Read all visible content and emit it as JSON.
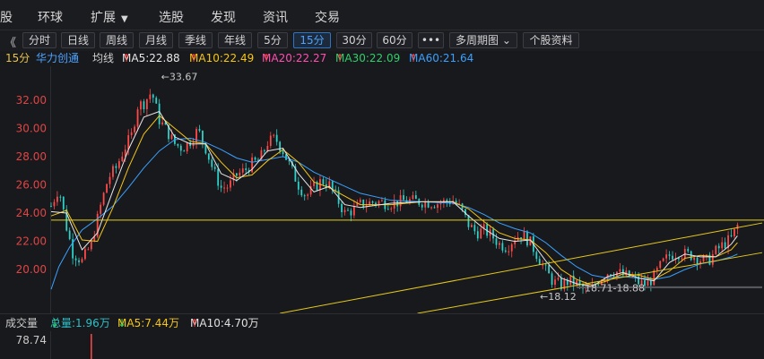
{
  "nav": {
    "items": [
      "股",
      "环球",
      "扩展",
      "选股",
      "发现",
      "资讯",
      "交易"
    ]
  },
  "toolbar": {
    "collapse": "《",
    "periods": [
      "分时",
      "日线",
      "周线",
      "月线",
      "季线",
      "年线",
      "5分",
      "15分",
      "30分",
      "60分",
      "•••",
      "多周期图",
      "个股资料"
    ],
    "active": "15分"
  },
  "ma_bar": {
    "period": "15分",
    "name": "华力创通",
    "ma_label": "均线",
    "ma5": "MA5:22.88",
    "ma10": "MA10:22.49",
    "ma20": "MA20:22.27",
    "ma30": "MA30:22.09",
    "ma60": "MA60:21.64",
    "up_arrow": "↑",
    "colors": {
      "ma5": "#e8e8e8",
      "ma10": "#f5c518",
      "ma20": "#ff4fb0",
      "ma30": "#2ed06a",
      "ma60": "#3aa0ff"
    }
  },
  "chart_data": {
    "type": "candlestick",
    "yticks": [
      "32.00",
      "30.00",
      "28.00",
      "26.00",
      "24.00",
      "22.00",
      "20.00"
    ],
    "ylim": [
      16.9,
      34.4
    ],
    "close_path": [
      [
        0,
        24.5
      ],
      [
        5,
        25.8
      ],
      [
        10,
        23.0
      ],
      [
        14,
        21.2
      ],
      [
        20,
        20.6
      ],
      [
        26,
        21.8
      ],
      [
        32,
        24.5
      ],
      [
        37,
        26.5
      ],
      [
        42,
        27.2
      ],
      [
        47,
        28.5
      ],
      [
        52,
        29.5
      ],
      [
        56,
        31.6
      ],
      [
        60,
        31.8
      ],
      [
        65,
        32.6
      ],
      [
        70,
        30.6
      ],
      [
        75,
        29.8
      ],
      [
        80,
        28.9
      ],
      [
        85,
        28.6
      ],
      [
        90,
        29.1
      ],
      [
        95,
        29.9
      ],
      [
        100,
        28.6
      ],
      [
        105,
        27.0
      ],
      [
        110,
        25.8
      ],
      [
        115,
        25.9
      ],
      [
        120,
        26.7
      ],
      [
        125,
        27.0
      ],
      [
        130,
        27.5
      ],
      [
        135,
        27.8
      ],
      [
        140,
        29.0
      ],
      [
        145,
        29.3
      ],
      [
        150,
        28.4
      ],
      [
        155,
        27.2
      ],
      [
        160,
        26.0
      ],
      [
        165,
        25.2
      ],
      [
        170,
        25.8
      ],
      [
        175,
        26.3
      ],
      [
        180,
        26.0
      ],
      [
        185,
        25.0
      ],
      [
        190,
        24.0
      ],
      [
        195,
        24.2
      ],
      [
        200,
        24.6
      ],
      [
        210,
        24.8
      ],
      [
        220,
        24.7
      ],
      [
        230,
        24.9
      ],
      [
        240,
        24.8
      ],
      [
        250,
        24.7
      ],
      [
        260,
        24.9
      ],
      [
        265,
        24.3
      ],
      [
        270,
        23.2
      ],
      [
        275,
        22.6
      ],
      [
        280,
        22.8
      ],
      [
        285,
        22.4
      ],
      [
        290,
        21.8
      ],
      [
        295,
        21.6
      ],
      [
        300,
        22.3
      ],
      [
        305,
        22.5
      ],
      [
        310,
        21.9
      ],
      [
        315,
        20.9
      ],
      [
        320,
        19.9
      ],
      [
        325,
        19.1
      ],
      [
        330,
        18.9
      ],
      [
        335,
        19.2
      ],
      [
        340,
        19.0
      ],
      [
        345,
        18.5
      ],
      [
        350,
        18.7
      ],
      [
        355,
        19.4
      ],
      [
        360,
        19.8
      ],
      [
        365,
        19.9
      ],
      [
        370,
        19.6
      ],
      [
        375,
        19.5
      ],
      [
        380,
        19.1
      ],
      [
        385,
        18.9
      ],
      [
        390,
        19.5
      ],
      [
        395,
        20.4
      ],
      [
        400,
        21.0
      ],
      [
        405,
        21.2
      ],
      [
        410,
        21.1
      ],
      [
        415,
        21.0
      ],
      [
        420,
        20.7
      ],
      [
        425,
        20.6
      ],
      [
        430,
        21.3
      ],
      [
        435,
        21.8
      ],
      [
        440,
        22.2
      ],
      [
        444,
        23.1
      ]
    ],
    "ma5_path": [
      [
        0,
        24.1
      ],
      [
        10,
        24.0
      ],
      [
        20,
        21.4
      ],
      [
        30,
        22.6
      ],
      [
        40,
        25.6
      ],
      [
        50,
        28.5
      ],
      [
        60,
        30.8
      ],
      [
        70,
        31.2
      ],
      [
        80,
        29.4
      ],
      [
        90,
        28.9
      ],
      [
        100,
        28.9
      ],
      [
        110,
        26.8
      ],
      [
        120,
        26.3
      ],
      [
        130,
        27.1
      ],
      [
        140,
        28.4
      ],
      [
        150,
        28.6
      ],
      [
        160,
        26.8
      ],
      [
        170,
        25.5
      ],
      [
        180,
        25.9
      ],
      [
        190,
        24.6
      ],
      [
        200,
        24.4
      ],
      [
        220,
        24.7
      ],
      [
        240,
        24.8
      ],
      [
        260,
        24.8
      ],
      [
        270,
        23.8
      ],
      [
        280,
        22.9
      ],
      [
        290,
        22.2
      ],
      [
        300,
        22.0
      ],
      [
        310,
        22.1
      ],
      [
        320,
        20.6
      ],
      [
        330,
        19.4
      ],
      [
        340,
        19.0
      ],
      [
        350,
        18.8
      ],
      [
        360,
        19.5
      ],
      [
        370,
        19.8
      ],
      [
        380,
        19.4
      ],
      [
        390,
        19.2
      ],
      [
        400,
        20.5
      ],
      [
        410,
        21.1
      ],
      [
        420,
        20.9
      ],
      [
        430,
        20.9
      ],
      [
        440,
        21.8
      ],
      [
        444,
        22.4
      ]
    ],
    "ma10_path": [
      [
        0,
        23.8
      ],
      [
        10,
        24.2
      ],
      [
        20,
        22.1
      ],
      [
        30,
        22.0
      ],
      [
        40,
        24.4
      ],
      [
        50,
        27.2
      ],
      [
        60,
        29.6
      ],
      [
        70,
        30.9
      ],
      [
        80,
        30.0
      ],
      [
        90,
        29.1
      ],
      [
        100,
        28.9
      ],
      [
        110,
        27.6
      ],
      [
        120,
        26.5
      ],
      [
        130,
        26.7
      ],
      [
        140,
        27.7
      ],
      [
        150,
        28.5
      ],
      [
        160,
        27.6
      ],
      [
        170,
        26.2
      ],
      [
        180,
        25.8
      ],
      [
        190,
        25.2
      ],
      [
        200,
        24.6
      ],
      [
        220,
        24.6
      ],
      [
        240,
        24.8
      ],
      [
        260,
        24.8
      ],
      [
        270,
        24.3
      ],
      [
        280,
        23.4
      ],
      [
        290,
        22.6
      ],
      [
        300,
        22.2
      ],
      [
        310,
        22.1
      ],
      [
        320,
        21.2
      ],
      [
        330,
        20.0
      ],
      [
        340,
        19.3
      ],
      [
        350,
        18.9
      ],
      [
        360,
        19.2
      ],
      [
        370,
        19.7
      ],
      [
        380,
        19.6
      ],
      [
        390,
        19.3
      ],
      [
        400,
        19.9
      ],
      [
        410,
        20.8
      ],
      [
        420,
        21.0
      ],
      [
        430,
        20.9
      ],
      [
        440,
        21.4
      ],
      [
        444,
        21.9
      ]
    ],
    "ma60_path": [
      [
        0,
        18.6
      ],
      [
        5,
        20.2
      ],
      [
        12,
        21.6
      ],
      [
        20,
        22.8
      ],
      [
        30,
        23.6
      ],
      [
        40,
        24.5
      ],
      [
        50,
        25.8
      ],
      [
        60,
        27.2
      ],
      [
        70,
        28.4
      ],
      [
        80,
        29.2
      ],
      [
        90,
        29.3
      ],
      [
        100,
        29.0
      ],
      [
        110,
        28.5
      ],
      [
        120,
        27.9
      ],
      [
        130,
        27.6
      ],
      [
        140,
        27.8
      ],
      [
        150,
        28.0
      ],
      [
        160,
        27.6
      ],
      [
        170,
        26.9
      ],
      [
        180,
        26.4
      ],
      [
        190,
        25.9
      ],
      [
        200,
        25.4
      ],
      [
        220,
        24.9
      ],
      [
        240,
        24.8
      ],
      [
        260,
        24.7
      ],
      [
        270,
        24.4
      ],
      [
        280,
        23.9
      ],
      [
        290,
        23.3
      ],
      [
        300,
        22.9
      ],
      [
        310,
        22.6
      ],
      [
        320,
        21.9
      ],
      [
        330,
        21.0
      ],
      [
        340,
        20.2
      ],
      [
        350,
        19.6
      ],
      [
        360,
        19.4
      ],
      [
        370,
        19.5
      ],
      [
        380,
        19.4
      ],
      [
        390,
        19.3
      ],
      [
        400,
        19.5
      ],
      [
        410,
        20.0
      ],
      [
        420,
        20.4
      ],
      [
        430,
        20.6
      ],
      [
        440,
        20.9
      ],
      [
        444,
        21.1
      ]
    ],
    "hline": 23.5,
    "trend_lines": [
      {
        "from": [
          148,
          16.9
        ],
        "to": [
          460,
          23.3
        ]
      },
      {
        "from": [
          237,
          16.9
        ],
        "to": [
          460,
          21.2
        ]
      }
    ],
    "support_line": {
      "from": [
        340,
        18.75
      ],
      "to": [
        460,
        18.75
      ]
    },
    "annotations": [
      {
        "text": "←33.67",
        "x": 70,
        "y": 33.67
      },
      {
        "text": "←18.12",
        "x": 315,
        "y": 18.12
      },
      {
        "text": "18.71-18.88",
        "x": 344,
        "y": 18.71
      }
    ],
    "x_last": 460,
    "hline_color": "#e6d21a",
    "trend_color": "#e6c81a",
    "up_color": "#ff4a4a",
    "down_color": "#2ed0c8",
    "ma_colors": {
      "ma5": "#e8e8e8",
      "ma10": "#f5c518",
      "ma60": "#3aa0ff"
    }
  },
  "volume": {
    "label": "成交量",
    "total": "总量:1.96万",
    "ma5": "MA5:7.44万",
    "ma10": "MA10:4.70万",
    "ytick": "78.74",
    "arrow_up": "↑",
    "arrow_down": "↓",
    "marker_x": 26
  }
}
